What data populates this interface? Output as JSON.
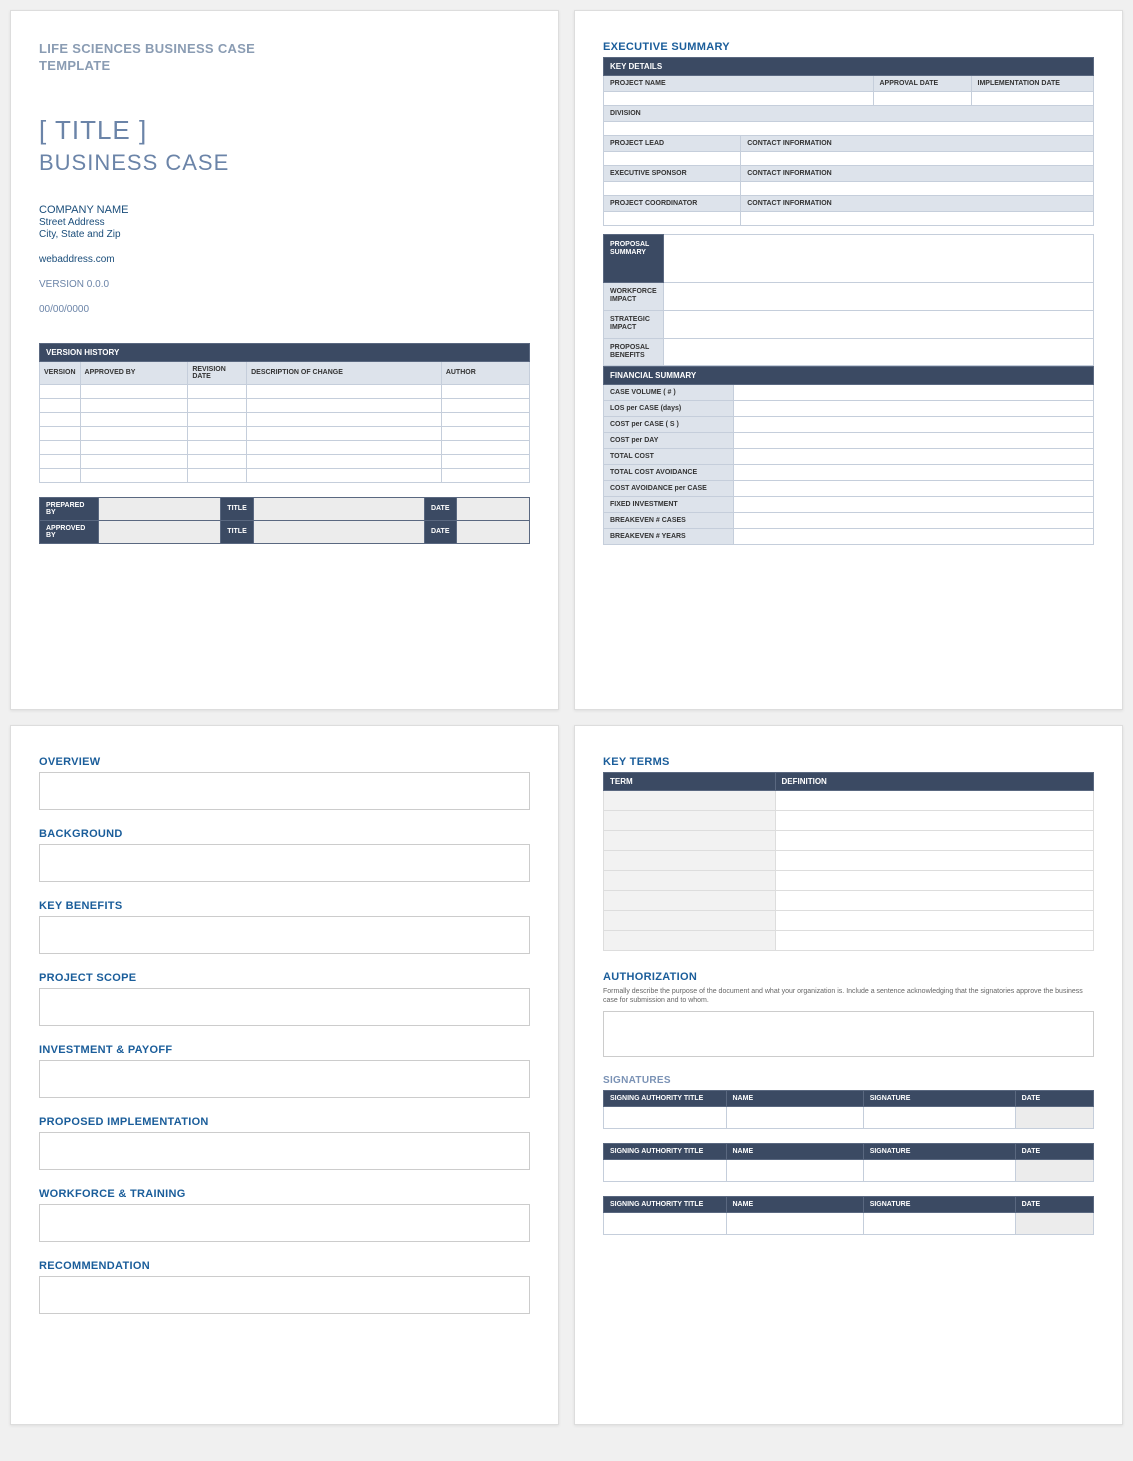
{
  "page1": {
    "doc_header_l1": "LIFE SCIENCES BUSINESS CASE",
    "doc_header_l2": "TEMPLATE",
    "title": "[ TITLE ]",
    "subtitle": "BUSINESS CASE",
    "company": "COMPANY NAME",
    "street": "Street Address",
    "citystate": "City, State and Zip",
    "web": "webaddress.com",
    "version": "VERSION 0.0.0",
    "date": "00/00/0000",
    "version_history_hdr": "VERSION HISTORY",
    "vh_cols": {
      "c1": "VERSION",
      "c2": "APPROVED BY",
      "c3": "REVISION DATE",
      "c4": "DESCRIPTION OF CHANGE",
      "c5": "AUTHOR"
    },
    "sign1": {
      "a": "PREPARED BY",
      "b": "TITLE",
      "c": "DATE"
    },
    "sign2": {
      "a": "APPROVED BY",
      "b": "TITLE",
      "c": "DATE"
    }
  },
  "page2": {
    "title": "EXECUTIVE SUMMARY",
    "key_details": "KEY DETAILS",
    "labels": {
      "project_name": "PROJECT NAME",
      "approval_date": "APPROVAL DATE",
      "impl_date": "IMPLEMENTATION DATE",
      "division": "DIVISION",
      "project_lead": "PROJECT LEAD",
      "contact_info": "CONTACT INFORMATION",
      "exec_sponsor": "EXECUTIVE SPONSOR",
      "proj_coord": "PROJECT COORDINATOR",
      "proposal_summary": "PROPOSAL SUMMARY",
      "workforce_impact": "WORKFORCE IMPACT",
      "strategic_impact": "STRATEGIC IMPACT",
      "proposal_benefits": "PROPOSAL BENEFITS",
      "financial_summary": "FINANCIAL SUMMARY",
      "case_volume": "CASE VOLUME ( # )",
      "los_per_case": "LOS per CASE (days)",
      "cost_per_case": "COST per CASE ( S )",
      "cost_per_day": "COST per DAY",
      "total_cost": "TOTAL COST",
      "total_cost_avoid": "TOTAL COST AVOIDANCE",
      "cost_avoid_per_case": "COST AVOIDANCE per CASE",
      "fixed_investment": "FIXED INVESTMENT",
      "breakeven_cases": "BREAKEVEN # CASES",
      "breakeven_years": "BREAKEVEN # YEARS"
    }
  },
  "page3": {
    "s1": "OVERVIEW",
    "s2": "BACKGROUND",
    "s3": "KEY BENEFITS",
    "s4": "PROJECT SCOPE",
    "s5": "INVESTMENT & PAYOFF",
    "s6": "PROPOSED IMPLEMENTATION",
    "s7": "WORKFORCE & TRAINING",
    "s8": "RECOMMENDATION"
  },
  "page4": {
    "key_terms": "KEY TERMS",
    "kt_cols": {
      "c1": "TERM",
      "c2": "DEFINITION"
    },
    "authorization": "AUTHORIZATION",
    "auth_desc": "Formally describe the purpose of the document and what your organization is. Include a sentence acknowledging that the signatories approve the business case for submission and to whom.",
    "signatures": "SIGNATURES",
    "sig_cols": {
      "c1": "SIGNING AUTHORITY TITLE",
      "c2": "NAME",
      "c3": "SIGNATURE",
      "c4": "DATE"
    }
  }
}
